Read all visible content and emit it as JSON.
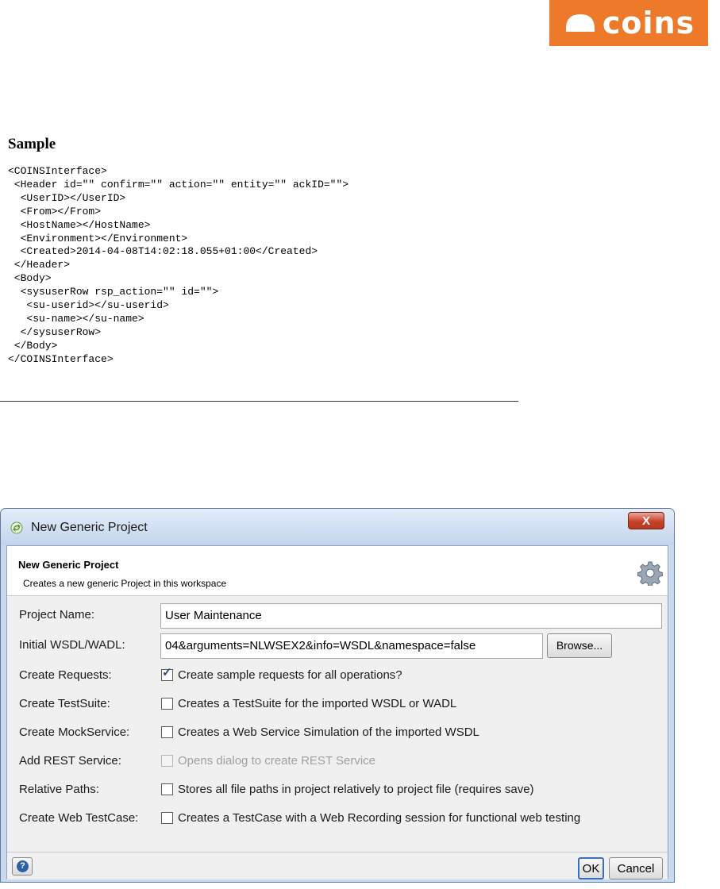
{
  "brand": {
    "logo_text": "coins",
    "color": "#ec7a2a"
  },
  "sample": {
    "heading": "Sample",
    "code_lines": [
      "<COINSInterface>",
      " <Header id=\"\" confirm=\"\" action=\"\" entity=\"\" ackID=\"\">",
      "  <UserID></UserID>",
      "  <From></From>",
      "  <HostName></HostName>",
      "  <Environment></Environment>",
      "  <Created>2014-04-08T14:02:18.055+01:00</Created>",
      " </Header>",
      " <Body>",
      "  <sysuserRow rsp_action=\"\" id=\"\">",
      "   <su-userid></su-userid>",
      "   <su-name></su-name>",
      "  </sysuserRow>",
      " </Body>",
      "</COINSInterface>"
    ]
  },
  "dialog": {
    "window_title": "New Generic Project",
    "close_label": "X",
    "header": {
      "title": "New Generic Project",
      "subtitle": "Creates a new generic Project in this workspace",
      "icon": "gear-icon"
    },
    "fields": {
      "project_name": {
        "label": "Project Name:",
        "value": "User Maintenance"
      },
      "initial_wsdl": {
        "label": "Initial WSDL/WADL:",
        "value": "04&arguments=NLWSEX2&info=WSDL&namespace=false",
        "browse_label": "Browse..."
      }
    },
    "options": [
      {
        "label": "Create Requests:",
        "text": "Create sample requests for all operations?",
        "checked": true,
        "enabled": true
      },
      {
        "label": "Create TestSuite:",
        "text": "Creates a TestSuite for the imported WSDL or WADL",
        "checked": false,
        "enabled": true
      },
      {
        "label": "Create MockService:",
        "text": "Creates a Web Service Simulation of the imported WSDL",
        "checked": false,
        "enabled": true
      },
      {
        "label": "Add REST Service:",
        "text": "Opens dialog to create REST Service",
        "checked": false,
        "enabled": false
      },
      {
        "label": "Relative Paths:",
        "text": "Stores all file paths in project relatively to project file (requires save)",
        "checked": false,
        "enabled": true
      },
      {
        "label": "Create Web TestCase:",
        "text": "Creates a TestCase with a Web Recording session for functional web testing",
        "checked": false,
        "enabled": true
      }
    ],
    "buttons": {
      "help": "?",
      "ok": "OK",
      "cancel": "Cancel"
    }
  }
}
